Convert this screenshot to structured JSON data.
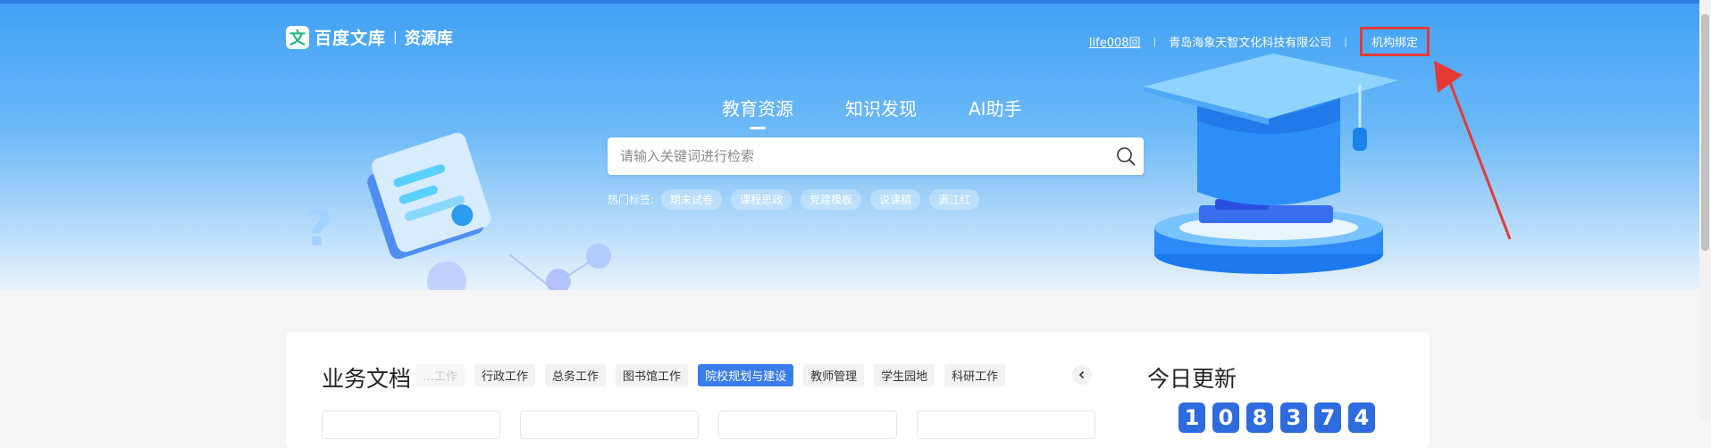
{
  "header": {
    "logo_mark": "文",
    "logo_text": "百度文库",
    "logo_sep": "|",
    "logo_sub": "资源库",
    "username": "life008回",
    "separator": "|",
    "organization": "青岛海象天智文化科技有限公司",
    "bind_label": "机构绑定"
  },
  "hero": {
    "tabs": [
      {
        "label": "教育资源",
        "active": true
      },
      {
        "label": "知识发现",
        "active": false
      },
      {
        "label": "AI助手",
        "active": false
      }
    ],
    "search": {
      "placeholder": "请输入关键词进行检索",
      "value": ""
    },
    "hot_label": "热门标签:",
    "hot_tags": [
      "期末试卷",
      "课程思政",
      "党建模板",
      "说课稿",
      "满江红"
    ]
  },
  "business": {
    "title": "业务文档",
    "tabs": [
      {
        "label": "…工作",
        "state": "faded"
      },
      {
        "label": "行政工作",
        "state": "normal"
      },
      {
        "label": "总务工作",
        "state": "normal"
      },
      {
        "label": "图书馆工作",
        "state": "normal"
      },
      {
        "label": "院校规划与建设",
        "state": "active"
      },
      {
        "label": "教师管理",
        "state": "normal"
      },
      {
        "label": "学生园地",
        "state": "normal"
      },
      {
        "label": "科研工作",
        "state": "normal"
      }
    ]
  },
  "today": {
    "title": "今日更新",
    "digits": [
      "1",
      "0",
      "8",
      "3",
      "7",
      "4"
    ]
  },
  "colors": {
    "accent": "#3a7cf0",
    "highlight_box": "#e53935",
    "logo_green": "#1fb97b",
    "digit_bg": "#2d6bdf"
  }
}
